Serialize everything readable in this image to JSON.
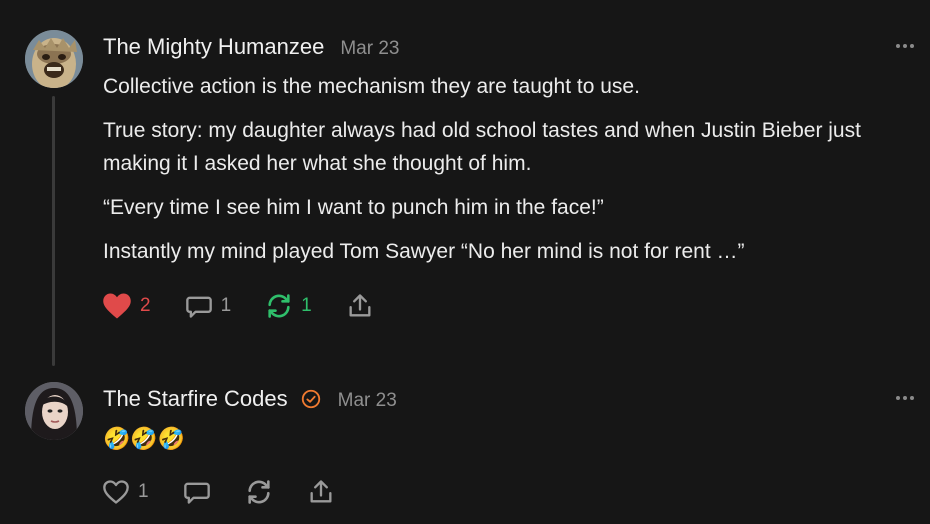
{
  "colors": {
    "background": "#161616",
    "liked": "#e04a4a",
    "restacked": "#2fbf6b",
    "verified": "#f07a30"
  },
  "comments": [
    {
      "author": "The Mighty Humanzee",
      "date": "Mar 23",
      "avatar": "gorilla-mask-avatar",
      "paragraphs": [
        "Collective action is the mechanism they are taught to use.",
        "True story: my daughter always had old school tastes and when Justin Bieber just making it I asked her what she thought of him.",
        "“Every time I see him I want to punch him in the face!”",
        "Instantly my mind played Tom Sawyer “No her mind is not for rent …”"
      ],
      "likes": "2",
      "replies": "1",
      "restacks": "1"
    },
    {
      "author": "The Starfire Codes",
      "date": "Mar 23",
      "avatar": "woman-portrait-avatar",
      "verified": true,
      "text": "🤣🤣🤣",
      "likes": "1"
    }
  ]
}
